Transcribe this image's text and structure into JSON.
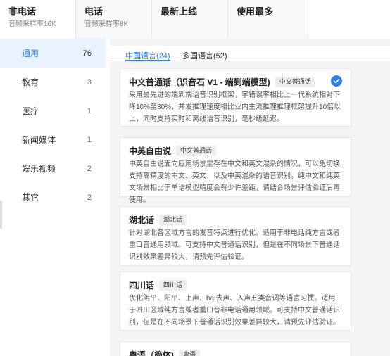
{
  "top_tabs": [
    {
      "title": "非电话",
      "subtitle": "音频采样率16K"
    },
    {
      "title": "电话",
      "subtitle": "音频采样率8K"
    },
    {
      "title": "最新上线",
      "subtitle": ""
    },
    {
      "title": "使用最多",
      "subtitle": ""
    }
  ],
  "sidebar": {
    "items": [
      {
        "label": "通用",
        "count": "76"
      },
      {
        "label": "教育",
        "count": "3"
      },
      {
        "label": "医疗",
        "count": "1"
      },
      {
        "label": "新闻媒体",
        "count": "1"
      },
      {
        "label": "娱乐视频",
        "count": "2"
      },
      {
        "label": "其它",
        "count": "2"
      }
    ]
  },
  "subtabs": {
    "chinese": "中国语言(24)",
    "multi": "多国语言(52)"
  },
  "models": [
    {
      "name": "中文普通话（识音石 V1 - 端到端模型)",
      "tag": "中文普通话",
      "desc": "采用最先进的端到端语音识别框架，字错误率相比上一代系统相对下降10%至30%，并发推理速度相比业内主流推理推理框架提升10倍以上，同时支持实时和离线语音识别，毫秒级延迟。",
      "selected": true
    },
    {
      "name": "中英自由说",
      "tag": "中文普通话",
      "desc": "中英自由说面向应用场景里存在中文和英文混杂的情况，可以兔切换支持高精度的中文、英文、以及中英混杂的语音识别。纯中文和纯英文场景相比于单语模型精度会有少许差距，请结合场景评估验证后再使用。",
      "selected": false
    },
    {
      "name": "湖北话",
      "tag": "湖北话",
      "desc": "针对湖北各区域方言的发音特点进行优化。适用于非电话纯方言或者重口音通用领域。可支持中文普通话识别，但是在不同场景下普通话识别效果差异较大，请预先评估验证。",
      "selected": false
    },
    {
      "name": "四川话",
      "tag": "四川话",
      "desc": "优化阴平、阳平、上声、bai去声、入声五类音调等语言习惯。适用于四川区域纯方言或者重口音非电话通用领域。可支持中文普通话识别，但是在不同场景下普通话识别效果差异较大，请预先评估验证。",
      "selected": false
    },
    {
      "name": "粤语（简体)",
      "tag": "粤语",
      "desc": "",
      "selected": false
    }
  ]
}
